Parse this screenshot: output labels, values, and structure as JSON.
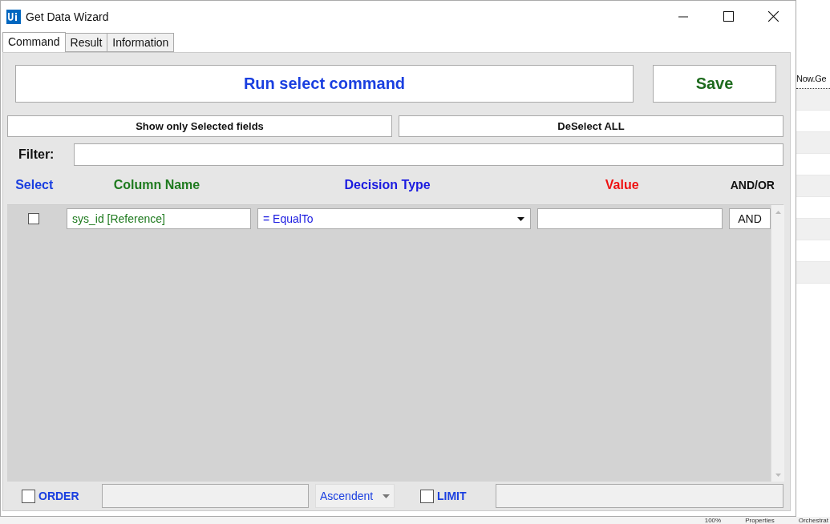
{
  "window": {
    "title": "Get Data Wizard"
  },
  "tabs": [
    {
      "label": "Command",
      "selected": true
    },
    {
      "label": "Result",
      "selected": false
    },
    {
      "label": "Information",
      "selected": false
    }
  ],
  "buttons": {
    "run": "Run select command",
    "save": "Save",
    "show_selected": "Show only Selected fields",
    "deselect_all": "DeSelect ALL"
  },
  "filter": {
    "label": "Filter:"
  },
  "columns": [
    {
      "label": "Select",
      "color": "#1a3fe0"
    },
    {
      "label": "Column Name",
      "color": "#1e7a1e"
    },
    {
      "label": "Decision Type",
      "color": "#1a1ae0"
    },
    {
      "label": "Value",
      "color": "#ee1111"
    },
    {
      "label": "AND/OR",
      "color": "#111111"
    }
  ],
  "rows": [
    {
      "checked": false,
      "column_name": "sys_id [Reference]",
      "decision_type": "= EqualTo",
      "conjunction": "AND"
    }
  ],
  "order": {
    "label": "ORDER",
    "checked": false,
    "direction": "Ascendent"
  },
  "limit": {
    "label": "LIMIT",
    "checked": false
  },
  "background": {
    "side_text": "Now.Ge",
    "status_items": [
      "100%",
      "Properties",
      "Orchestrat"
    ]
  }
}
